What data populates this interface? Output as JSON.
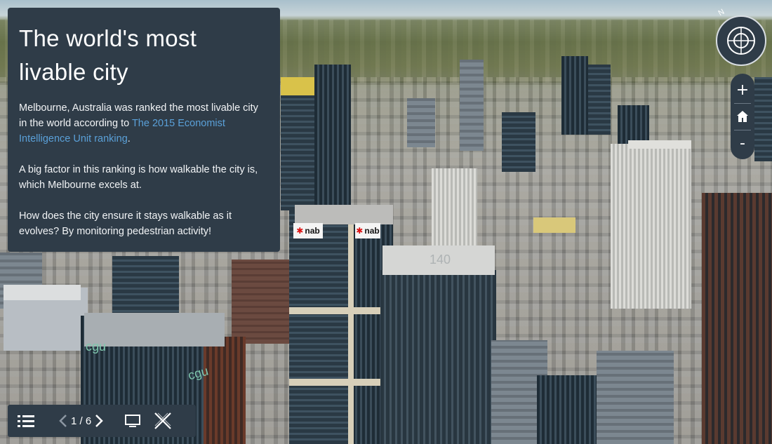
{
  "panel": {
    "title": "The world's most livable city",
    "p1_text": "Melbourne, Australia was ranked the most livable city in the world according to ",
    "p1_link": "The 2015 Economist Intelligence Unit ranking",
    "p1_end": ".",
    "p2": "A big factor in this ranking is how walkable the city is, which Melbourne excels at.",
    "p3": "How does the city ensure it stays walkable as it evolves? By monitoring pedestrian activity!"
  },
  "map_controls": {
    "compass_label": "N",
    "zoom_in": "+",
    "zoom_out": "-"
  },
  "building_signs": {
    "nab": "nab",
    "cgu": "cgu",
    "number": "140"
  },
  "toolbar": {
    "page_indicator": "1 / 6"
  },
  "icons": [
    "list-icon",
    "chevron-left-icon",
    "chevron-right-icon",
    "monitor-icon",
    "close-x-icon",
    "compass-icon",
    "home-icon"
  ],
  "colors": {
    "panel_bg": "#2f3c48",
    "link": "#5aa0d8",
    "text": "#ffffff"
  }
}
